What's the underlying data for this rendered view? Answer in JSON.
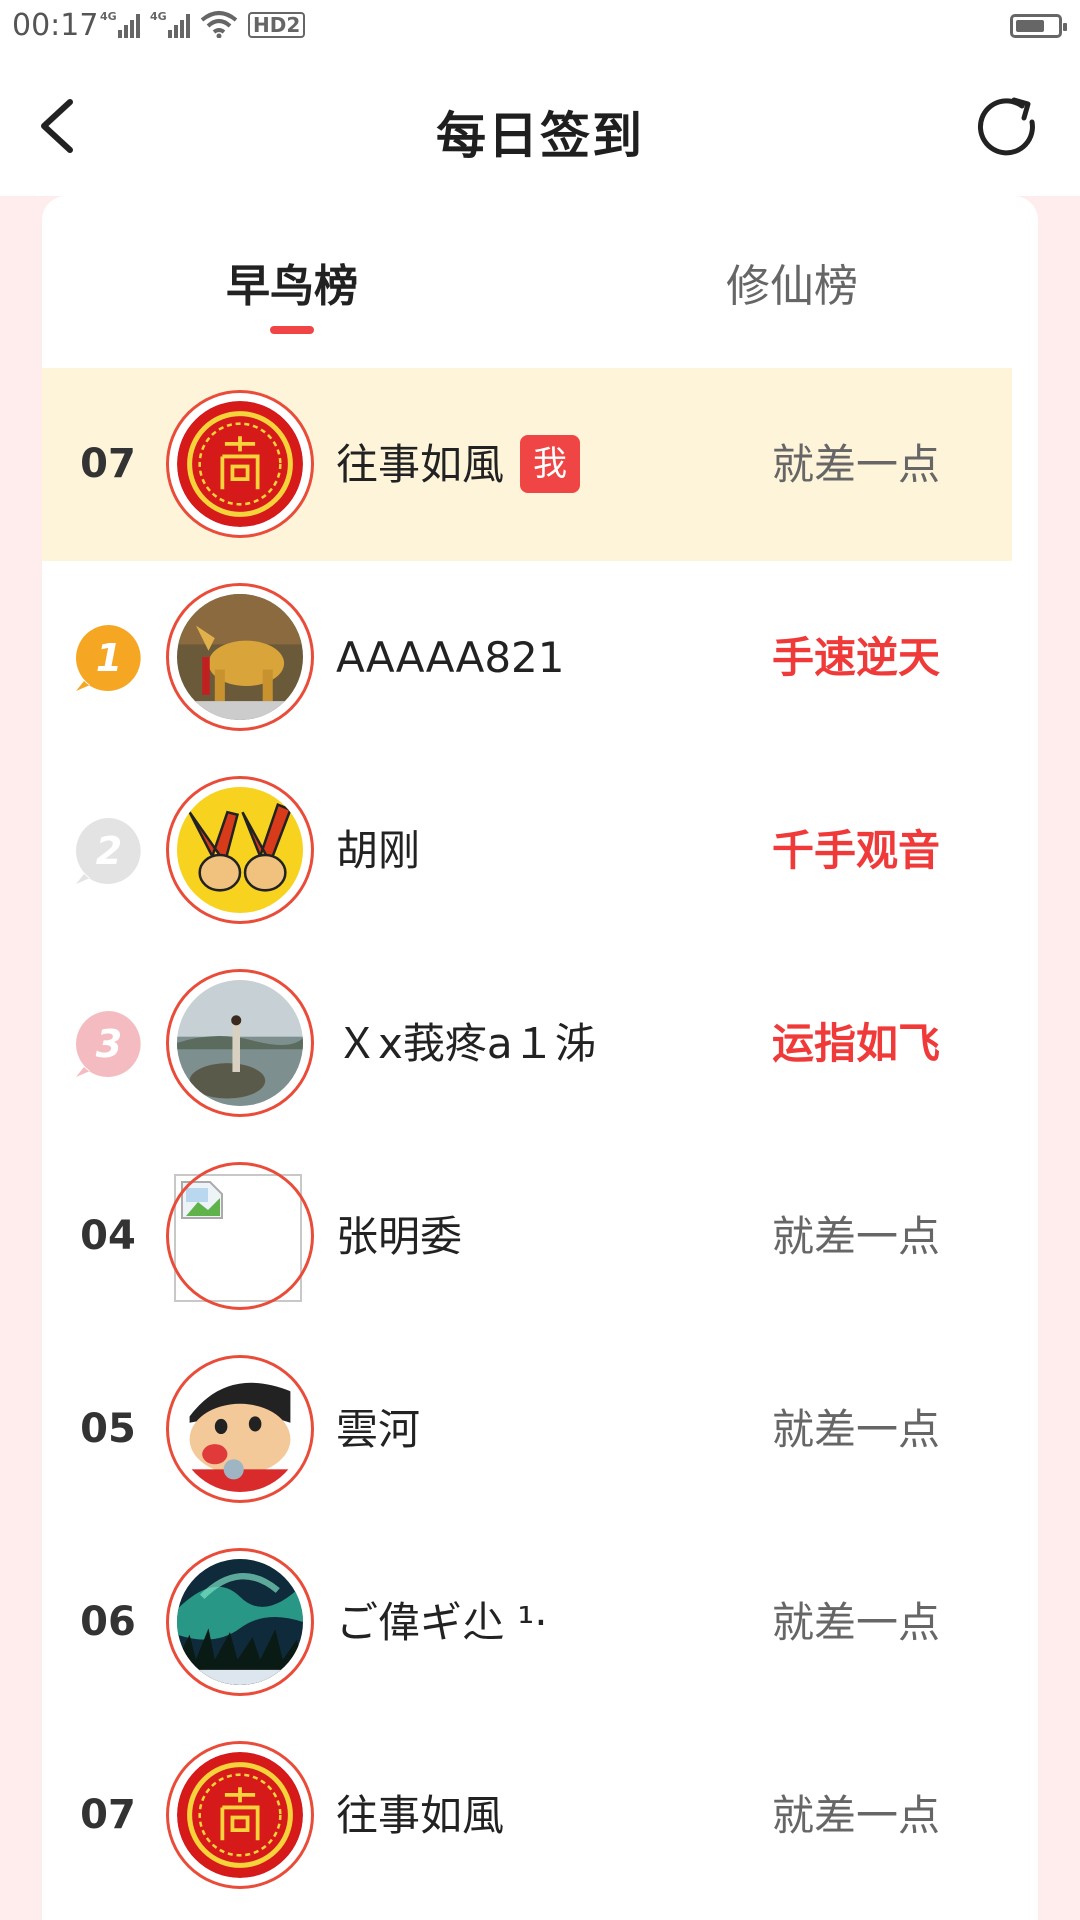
{
  "status_bar": {
    "time": "00:17",
    "network_1": "4G",
    "network_2": "4G",
    "hd_label": "HD2",
    "battery_level": 0.7
  },
  "header": {
    "title": "每日签到",
    "back_icon": "chevron-left-icon",
    "refresh_icon": "refresh-icon"
  },
  "tabs": [
    {
      "label": "早鸟榜",
      "active": true
    },
    {
      "label": "修仙榜",
      "active": false
    }
  ],
  "colors": {
    "accent": "#f14545",
    "highlight_row": "#fdf4da",
    "page_bg": "#ffeded",
    "gold_medal": "#f5a623",
    "silver_medal": "#d9d9d9",
    "bronze_medal": "#f0b3b8"
  },
  "me_row": {
    "rank": "07",
    "name": "往事如風",
    "badge": "我",
    "status": "就差一点"
  },
  "rows": [
    {
      "rank": "1",
      "medal": "gold",
      "name": "AAAAA821",
      "status": "手速逆天",
      "hot": true,
      "avatar": "golden-statue"
    },
    {
      "rank": "2",
      "medal": "silver",
      "name": "胡刚",
      "status": "千手观音",
      "hot": true,
      "avatar": "victory-hands"
    },
    {
      "rank": "3",
      "medal": "bronze",
      "name": "Ｘx莪疼a１泲",
      "status": "运指如飞",
      "hot": true,
      "avatar": "lake-photo"
    },
    {
      "rank": "04",
      "name": "张明委",
      "status": "就差一点",
      "hot": false,
      "avatar": "broken-image"
    },
    {
      "rank": "05",
      "name": "雲河",
      "status": "就差一点",
      "hot": false,
      "avatar": "cartoon-boy"
    },
    {
      "rank": "06",
      "name": "ご偉ギ尐 ¹·",
      "status": "就差一点",
      "hot": false,
      "avatar": "aurora"
    },
    {
      "rank": "07",
      "name": "往事如風",
      "status": "就差一点",
      "hot": false,
      "avatar": "red-seal"
    }
  ]
}
